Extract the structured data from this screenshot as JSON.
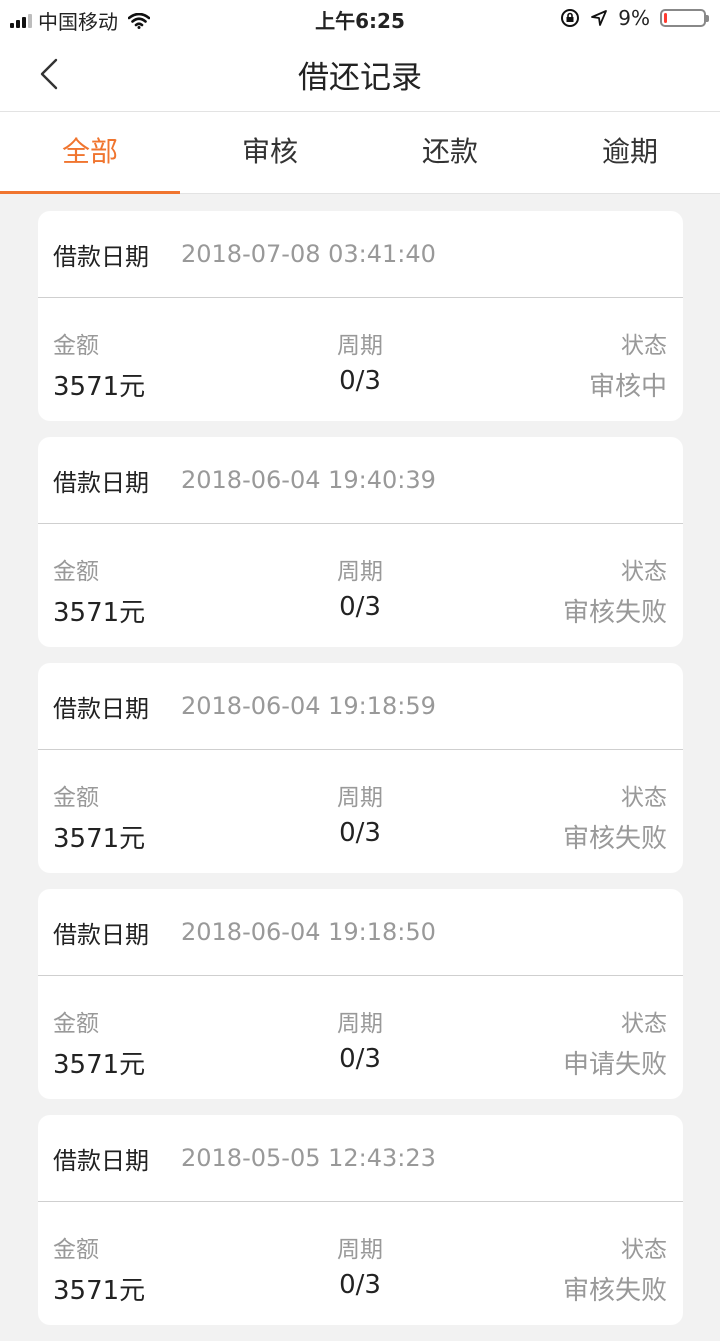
{
  "status_bar": {
    "carrier": "中国移动",
    "time": "上午6:25",
    "battery": "9%",
    "battery_level": 0.09
  },
  "nav": {
    "title": "借还记录"
  },
  "tabs": [
    {
      "label": "全部",
      "active": true
    },
    {
      "label": "审核",
      "active": false
    },
    {
      "label": "还款",
      "active": false
    },
    {
      "label": "逾期",
      "active": false
    }
  ],
  "labels": {
    "date": "借款日期",
    "amount": "金额",
    "period": "周期",
    "status": "状态"
  },
  "records": [
    {
      "date": "2018-07-08 03:41:40",
      "amount": "3571元",
      "period": "0/3",
      "status": "审核中"
    },
    {
      "date": "2018-06-04 19:40:39",
      "amount": "3571元",
      "period": "0/3",
      "status": "审核失败"
    },
    {
      "date": "2018-06-04 19:18:59",
      "amount": "3571元",
      "period": "0/3",
      "status": "审核失败"
    },
    {
      "date": "2018-06-04 19:18:50",
      "amount": "3571元",
      "period": "0/3",
      "status": "申请失败"
    },
    {
      "date": "2018-05-05 12:43:23",
      "amount": "3571元",
      "period": "0/3",
      "status": "审核失败"
    }
  ],
  "colors": {
    "accent": "#f0752f",
    "background": "#f2f2f2",
    "muted_text": "#999999"
  }
}
